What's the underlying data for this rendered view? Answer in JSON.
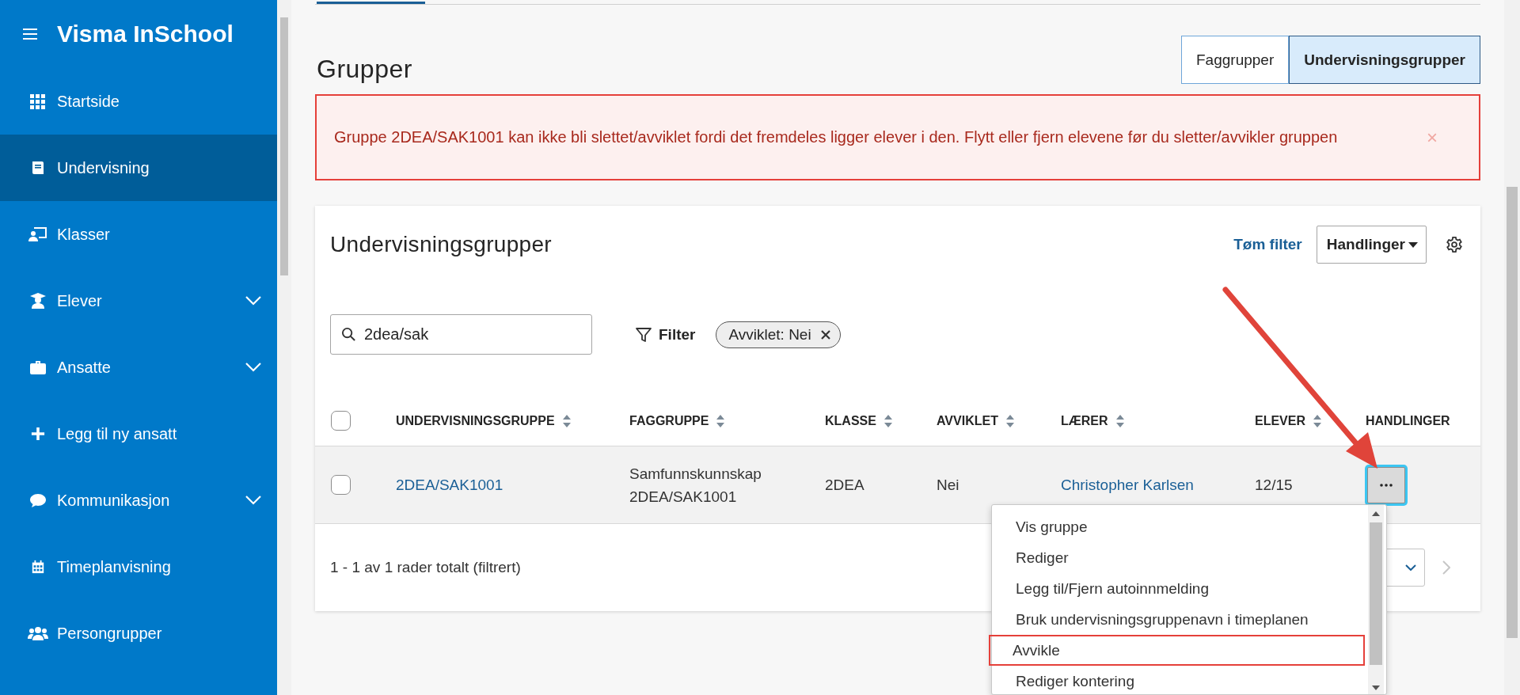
{
  "sidebar": {
    "title": "Visma InSchool",
    "items": [
      {
        "label": "Startside",
        "selected": false,
        "expandable": false
      },
      {
        "label": "Undervisning",
        "selected": true,
        "expandable": false
      },
      {
        "label": "Klasser",
        "selected": false,
        "expandable": false
      },
      {
        "label": "Elever",
        "selected": false,
        "expandable": true
      },
      {
        "label": "Ansatte",
        "selected": false,
        "expandable": true
      },
      {
        "label": "Legg til ny ansatt",
        "selected": false,
        "expandable": false
      },
      {
        "label": "Kommunikasjon",
        "selected": false,
        "expandable": true
      },
      {
        "label": "Timeplanvisning",
        "selected": false,
        "expandable": false
      },
      {
        "label": "Persongrupper",
        "selected": false,
        "expandable": false
      }
    ]
  },
  "page_title": "Grupper",
  "view_toggle": [
    {
      "label": "Faggrupper",
      "selected": false
    },
    {
      "label": "Undervisningsgrupper",
      "selected": true
    }
  ],
  "alert": {
    "text": "Gruppe 2DEA/SAK1001 kan ikke bli slettet/avviklet fordi det fremdeles ligger elever i den. Flytt eller fjern elevene før du sletter/avvikler gruppen",
    "close": "×"
  },
  "card": {
    "title": "Undervisningsgrupper",
    "clear_filter": "Tøm filter",
    "actions_button": "Handlinger",
    "search": {
      "value": "2dea/sak"
    },
    "filter_label": "Filter",
    "chips": [
      {
        "label": "Avviklet: Nei"
      }
    ],
    "table": {
      "all_checked": false,
      "columns": [
        {
          "label": "UNDERVISNINGSGRUPPE",
          "sortable": true
        },
        {
          "label": "FAGGRUPPE",
          "sortable": true
        },
        {
          "label": "KLASSE",
          "sortable": true
        },
        {
          "label": "AVVIKLET",
          "sortable": true
        },
        {
          "label": "LÆRER",
          "sortable": true
        },
        {
          "label": "ELEVER",
          "sortable": true
        },
        {
          "label": "HANDLINGER"
        }
      ],
      "rows": [
        {
          "selected": false,
          "cells": [
            {
              "kind": "link",
              "text": "2DEA/SAK1001"
            },
            {
              "kind": "text",
              "text": "Samfunnskunnskap 2DEA/SAK1001"
            },
            {
              "kind": "text",
              "text": "2DEA"
            },
            {
              "kind": "text",
              "text": "Nei"
            },
            {
              "kind": "link",
              "text": "Christopher Karlsen"
            },
            {
              "kind": "text",
              "text": "12/15"
            }
          ]
        }
      ]
    },
    "footer": "1 - 1 av 1 rader totalt (filtrert)"
  },
  "row_menu": {
    "items": [
      {
        "label": "Vis gruppe",
        "highlighted": false
      },
      {
        "label": "Rediger",
        "highlighted": false
      },
      {
        "label": "Legg til/Fjern autoinnmelding",
        "highlighted": false
      },
      {
        "label": "Bruk undervisningsgruppenavn i timeplanen",
        "highlighted": false
      },
      {
        "label": "Avvikle",
        "highlighted": true
      },
      {
        "label": "Rediger kontering",
        "highlighted": false
      }
    ]
  }
}
